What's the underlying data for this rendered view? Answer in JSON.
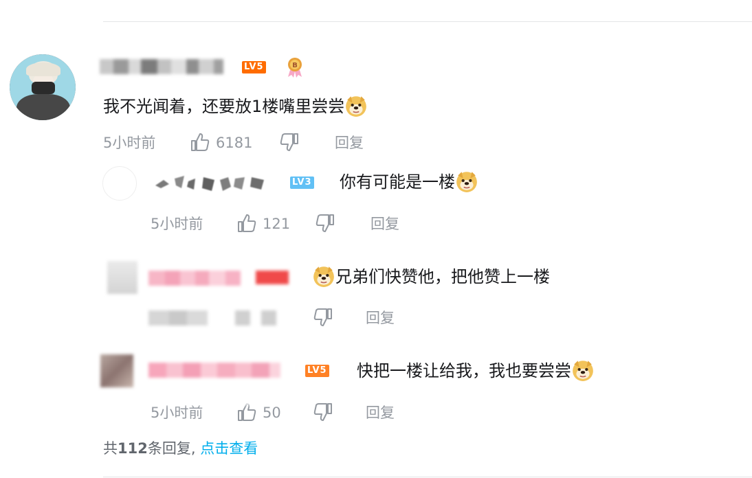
{
  "main_comment": {
    "level_badge": "LV5",
    "text": "我不光闻着，还要放1楼嘴里尝尝",
    "time": "5小时前",
    "like_count": "6181",
    "reply_label": "回复"
  },
  "replies": [
    {
      "level_badge": "LV3",
      "text": "你有可能是一楼",
      "time": "5小时前",
      "like_count": "121",
      "reply_label": "回复"
    },
    {
      "text": "兄弟们快赞他，把他赞上一楼",
      "reply_label": "回复"
    },
    {
      "level_badge": "LV5",
      "text": "快把一楼让给我，我也要尝尝",
      "time": "5小时前",
      "like_count": "50",
      "reply_label": "回复"
    }
  ],
  "reply_summary": {
    "prefix": "共",
    "count": "112",
    "suffix": "条回复,",
    "link": "点击查看"
  },
  "colors": {
    "accent_link": "#00aeec",
    "lv5": "#ff6c00",
    "lv3": "#61c0f5",
    "meta": "#9499a0"
  }
}
